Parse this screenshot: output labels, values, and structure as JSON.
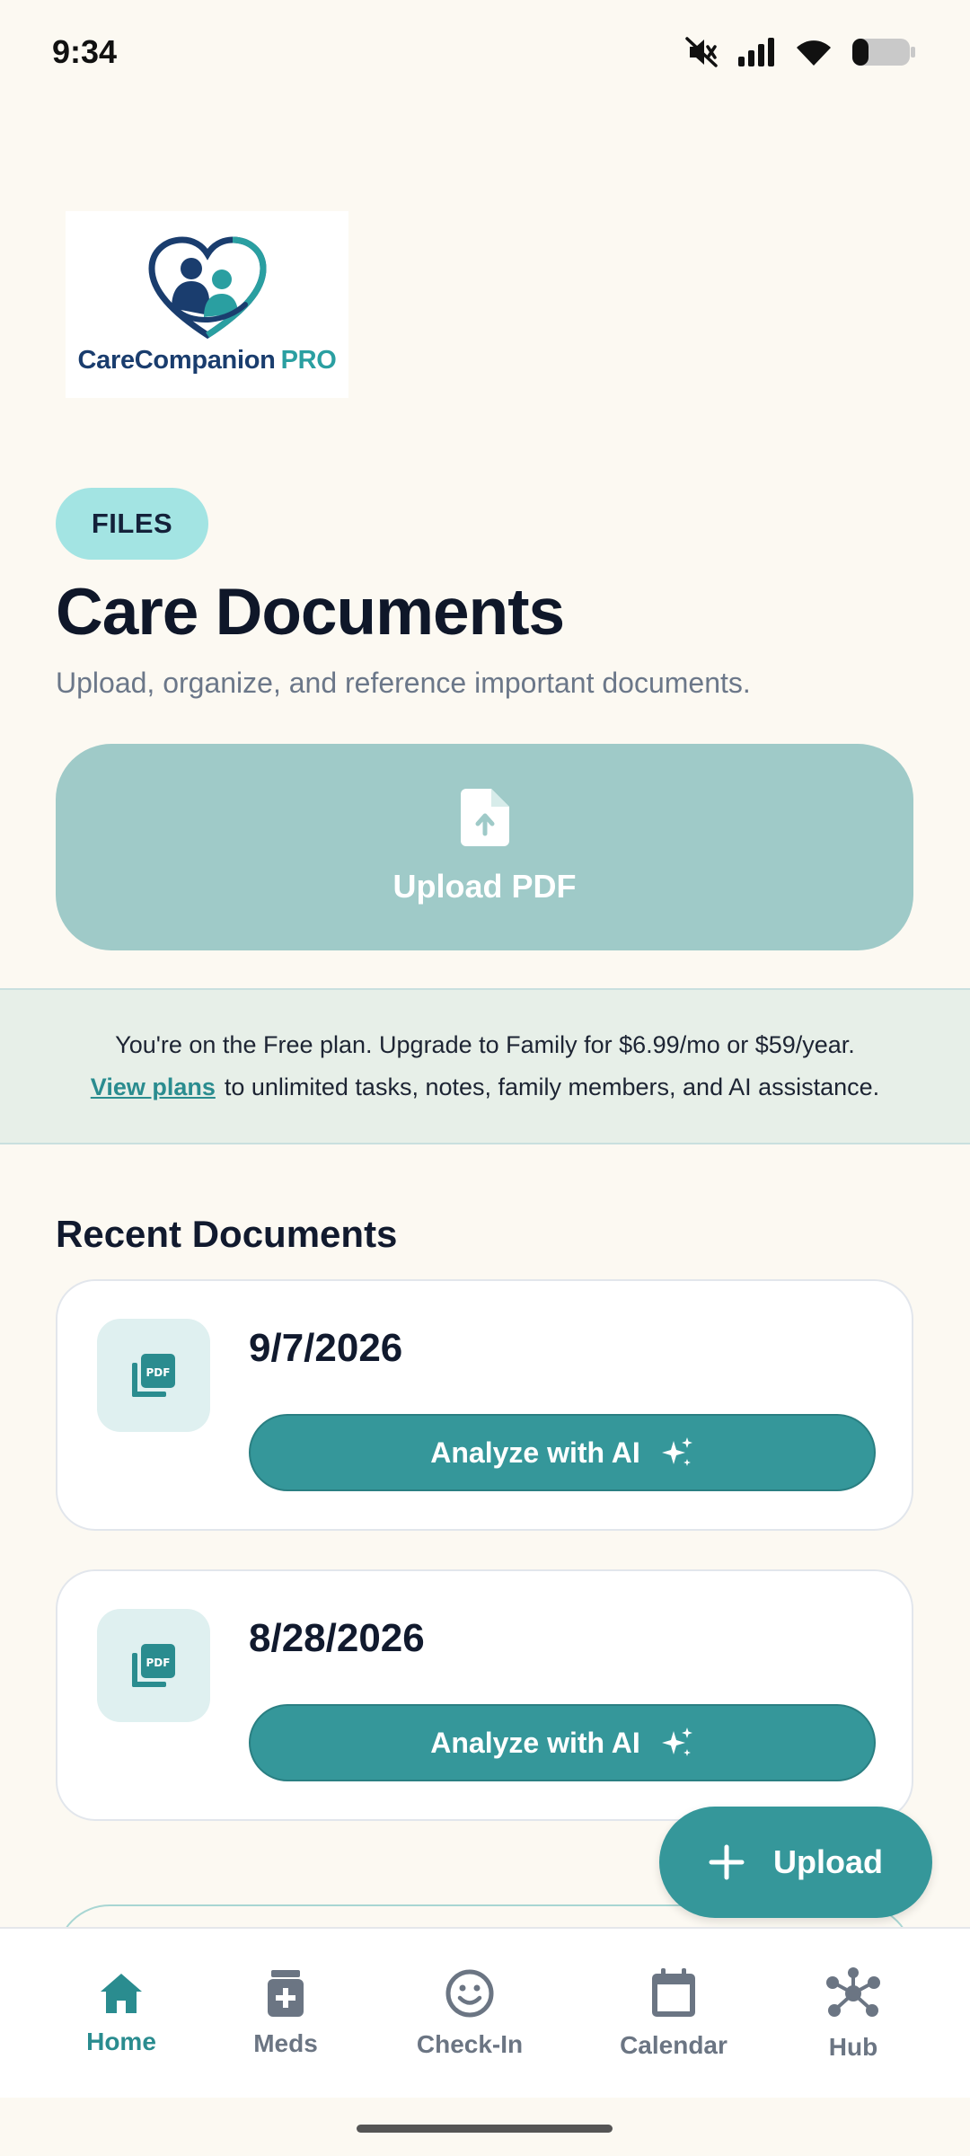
{
  "status_bar": {
    "time": "9:34",
    "icons": [
      "mute-icon",
      "signal-icon",
      "wifi-icon",
      "battery-icon"
    ]
  },
  "logo": {
    "name": "CareCompanion",
    "suffix": "PRO"
  },
  "header": {
    "badge": "FILES",
    "title": "Care Documents",
    "subtitle": "Upload, organize, and reference important documents."
  },
  "upload_card": {
    "label": "Upload PDF",
    "icon": "file-upload-icon"
  },
  "plan_banner": {
    "line1": "You're on the Free plan. Upgrade to Family for $6.99/mo or $59/year.",
    "link": "View plans",
    "line2_rest": "to unlimited tasks, notes, family members, and AI assistance."
  },
  "recent": {
    "title": "Recent Documents",
    "documents": [
      {
        "date": "9/7/2026",
        "action": "Analyze with AI",
        "icon": "pdf-icon"
      },
      {
        "date": "8/28/2026",
        "action": "Analyze with AI",
        "icon": "pdf-icon"
      }
    ]
  },
  "fab": {
    "label": "Upload",
    "icon": "plus-icon"
  },
  "nav": {
    "items": [
      {
        "label": "Home",
        "icon": "home-icon",
        "active": true
      },
      {
        "label": "Meds",
        "icon": "pill-bottle-icon",
        "active": false
      },
      {
        "label": "Check-In",
        "icon": "smiley-icon",
        "active": false
      },
      {
        "label": "Calendar",
        "icon": "calendar-icon",
        "active": false
      },
      {
        "label": "Hub",
        "icon": "hub-icon",
        "active": false
      }
    ]
  },
  "colors": {
    "background": "#fcf9f2",
    "accent": "#35979a",
    "upload_card": "#9fcac8",
    "badge": "#a3e4e3",
    "banner": "#e7efe8",
    "nav_active": "#2a8c8f",
    "nav_inactive": "#6b7583"
  }
}
